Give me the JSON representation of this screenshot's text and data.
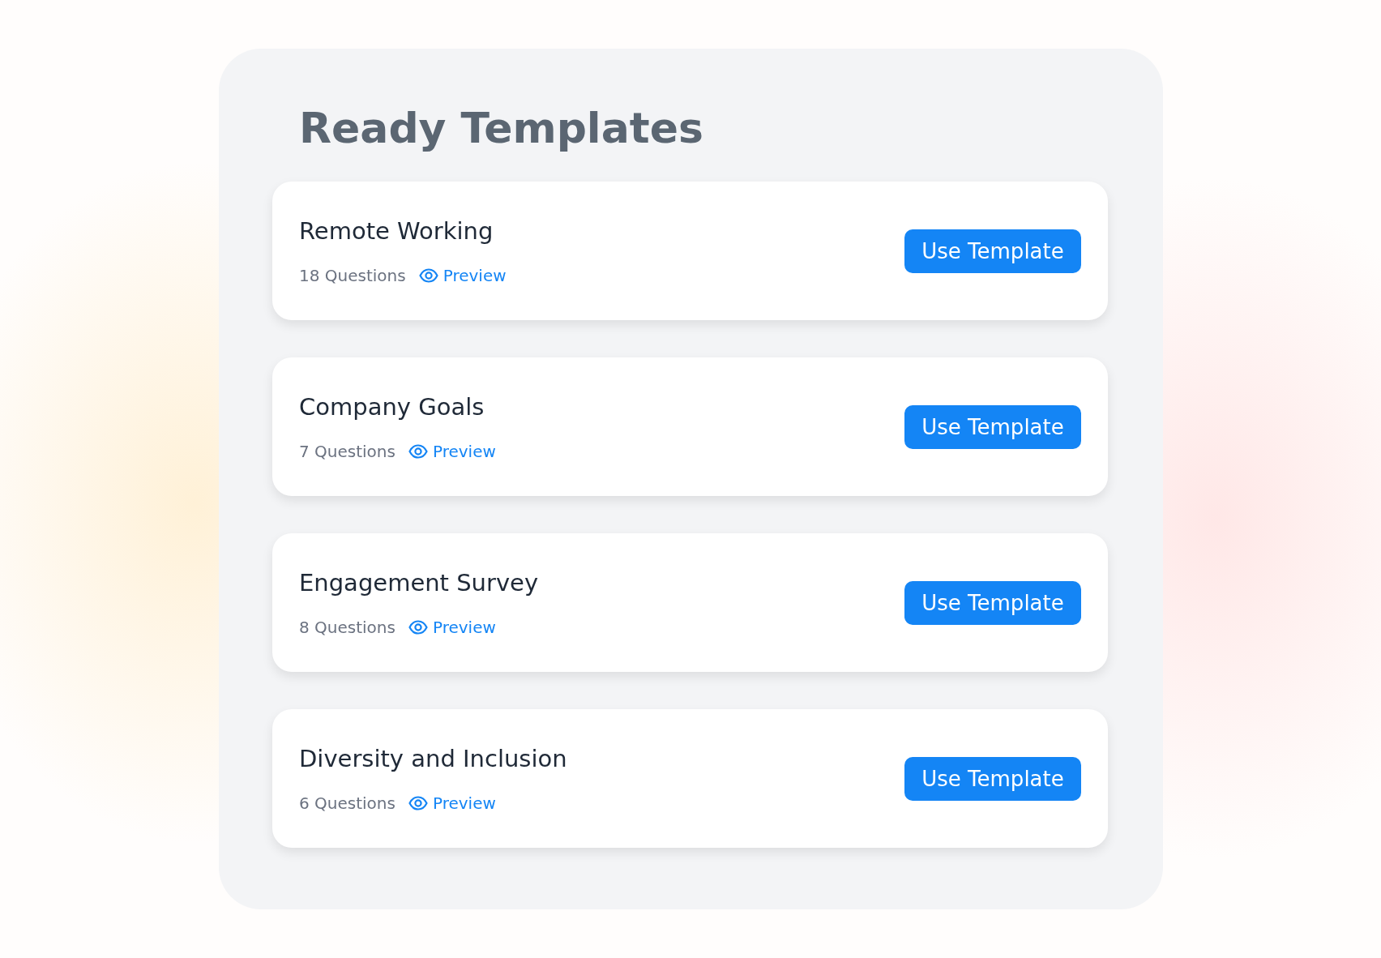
{
  "title": "Ready Templates",
  "templates": [
    {
      "name": "Remote Working",
      "questions": "18 Questions",
      "preview": "Preview",
      "action": "Use Template"
    },
    {
      "name": "Company Goals",
      "questions": "7 Questions",
      "preview": "Preview",
      "action": "Use Template"
    },
    {
      "name": "Engagement Survey",
      "questions": "8 Questions",
      "preview": "Preview",
      "action": "Use Template"
    },
    {
      "name": "Diversity and Inclusion",
      "questions": "6 Questions",
      "preview": "Preview",
      "action": "Use Template"
    }
  ]
}
